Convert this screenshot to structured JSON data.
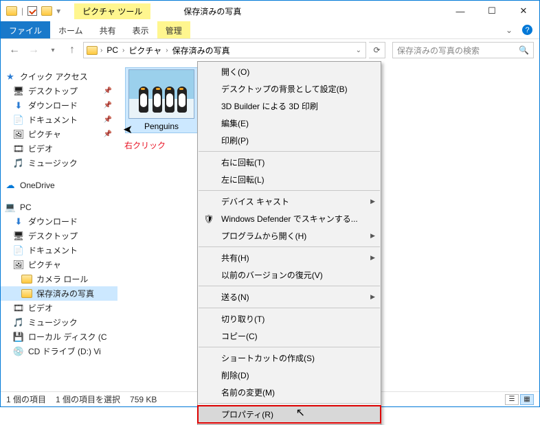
{
  "window": {
    "title": "保存済みの写真",
    "ctx_tab": "ピクチャ ツール",
    "ctx_sub": "管理"
  },
  "ribbon": {
    "file": "ファイル",
    "home": "ホーム",
    "share": "共有",
    "view": "表示"
  },
  "breadcrumb": {
    "p1": "PC",
    "p2": "ピクチャ",
    "p3": "保存済みの写真"
  },
  "search": {
    "placeholder": "保存済みの写真の検索"
  },
  "sidebar": {
    "quick": "クイック アクセス",
    "desktop": "デスクトップ",
    "downloads": "ダウンロード",
    "documents": "ドキュメント",
    "pictures": "ピクチャ",
    "videos": "ビデオ",
    "music": "ミュージック",
    "onedrive": "OneDrive",
    "pc": "PC",
    "cameraroll": "カメラ ロール",
    "saved": "保存済みの写真",
    "localdisk": "ローカル ディスク (C",
    "cddrive": "CD ドライブ (D:) Vi"
  },
  "file": {
    "name": "Penguins",
    "hint": "右クリック"
  },
  "menu": {
    "open": "開く(O)",
    "setbg": "デスクトップの背景として設定(B)",
    "3d": "3D Builder による 3D 印刷",
    "edit": "編集(E)",
    "print": "印刷(P)",
    "rotr": "右に回転(T)",
    "rotl": "左に回転(L)",
    "cast": "デバイス キャスト",
    "defender": "Windows Defender でスキャンする...",
    "openwith": "プログラムから開く(H)",
    "share": "共有(H)",
    "restore": "以前のバージョンの復元(V)",
    "sendto": "送る(N)",
    "cut": "切り取り(T)",
    "copy": "コピー(C)",
    "shortcut": "ショートカットの作成(S)",
    "delete": "削除(D)",
    "rename": "名前の変更(M)",
    "props": "プロパティ(R)"
  },
  "status": {
    "items": "1 個の項目",
    "sel": "1 個の項目を選択",
    "size": "759 KB"
  }
}
